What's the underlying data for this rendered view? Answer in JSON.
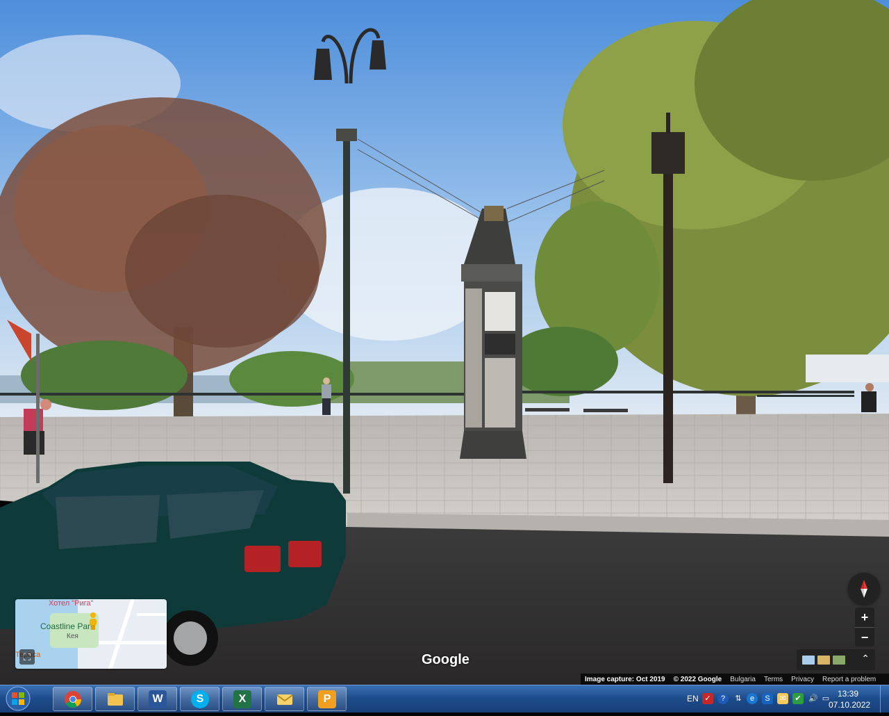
{
  "map": {
    "logo": "Google",
    "minimap": {
      "hotel_label": "Хотел \"Рига\"",
      "park_label": "Coastline Park",
      "park_sublabel": "Кея",
      "terasa_label": "Тераса",
      "expand_icon": "expand-icon"
    },
    "controls": {
      "zoom_in": "+",
      "zoom_out": "−",
      "imagery_chevron": "⌃"
    },
    "footer": {
      "capture": "Image capture: Oct 2019",
      "copyright": "© 2022 Google",
      "country": "Bulgaria",
      "terms": "Terms",
      "privacy": "Privacy",
      "report": "Report a problem"
    }
  },
  "taskbar": {
    "apps": [
      {
        "name": "chrome",
        "icon": "chrome-icon"
      },
      {
        "name": "explorer",
        "icon": "folder-icon"
      },
      {
        "name": "word",
        "label": "W",
        "icon": "word-icon"
      },
      {
        "name": "skype",
        "label": "S",
        "icon": "skype-icon"
      },
      {
        "name": "excel",
        "label": "X",
        "icon": "excel-icon"
      },
      {
        "name": "mail",
        "icon": "mail-icon"
      },
      {
        "name": "pdf",
        "label": "P",
        "icon": "pdf-icon"
      }
    ],
    "tray": {
      "language": "EN",
      "time": "13:39",
      "date": "07.10.2022"
    }
  },
  "colors": {
    "taskbar": "#1d4b8a",
    "sky": "#6fa6e0",
    "car": "#0e3b3a",
    "pavement": "#c9c4bd"
  }
}
